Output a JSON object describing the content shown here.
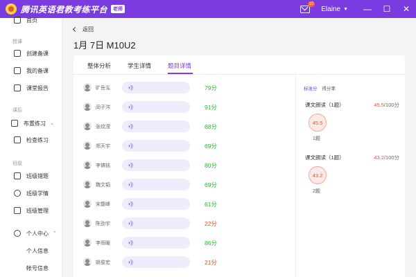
{
  "app": {
    "title": "腾讯英语君教考练平台",
    "role_badge": "老师",
    "notification_count": "10",
    "username": "Elaine",
    "window": {
      "minimize": "—",
      "maximize": "☐",
      "close": "✕"
    }
  },
  "sidebar": {
    "home": "首页",
    "sections": {
      "prepare": "授课",
      "after_class": "课后",
      "class": "班级"
    },
    "items": {
      "create_lesson": "创建备课",
      "my_lessons": "我的备课",
      "class_report": "课堂报告",
      "assign_practice": "布置练习",
      "check_practice": "检查练习",
      "class_mistakes": "班级错题",
      "class_learning": "班级学情",
      "class_manage": "班级管理",
      "personal_center": "个人中心",
      "personal_info": "个人信息",
      "account_info": "帐号信息"
    }
  },
  "main": {
    "back_label": "返回",
    "page_title": "1月 7日 M10U2",
    "tabs": [
      "整体分析",
      "学生详情",
      "题目详情"
    ],
    "active_tab": 2,
    "students": [
      {
        "name": "旷岳泓",
        "score": "79分",
        "color": "#2db33b"
      },
      {
        "name": "闵子涔",
        "score": "91分",
        "color": "#2db33b"
      },
      {
        "name": "张纹滢",
        "score": "68分",
        "color": "#2db33b"
      },
      {
        "name": "郑天宇",
        "score": "69分",
        "color": "#2db33b"
      },
      {
        "name": "李镐铭",
        "score": "80分",
        "color": "#2db33b"
      },
      {
        "name": "魏文韬",
        "score": "69分",
        "color": "#2db33b"
      },
      {
        "name": "宋馥峰",
        "score": "61分",
        "color": "#2db33b"
      },
      {
        "name": "陈劲宇",
        "score": "22分",
        "color": "#e0533a"
      },
      {
        "name": "李雨暖",
        "score": "86分",
        "color": "#2db33b"
      },
      {
        "name": "姚俊宏",
        "score": "21分",
        "color": "#e0533a"
      }
    ],
    "legend": {
      "standard": "标准分",
      "score_rate": "得分率"
    },
    "items": [
      {
        "name": "课文朗读（1题）",
        "score": "45.5",
        "total": "/100分",
        "bubble": "45.5",
        "count": "1题"
      },
      {
        "name": "课文朗读（1题）",
        "score": "43.2",
        "total": "/100分",
        "bubble": "43.2",
        "count": "2题"
      }
    ]
  },
  "colors": {
    "brand": "#7a3be0",
    "good": "#2db33b",
    "bad": "#e0533a"
  },
  "icons": [
    "home-icon",
    "mail-icon",
    "speaker-wave-icon",
    "avatar-icon",
    "back-chevron-icon"
  ]
}
